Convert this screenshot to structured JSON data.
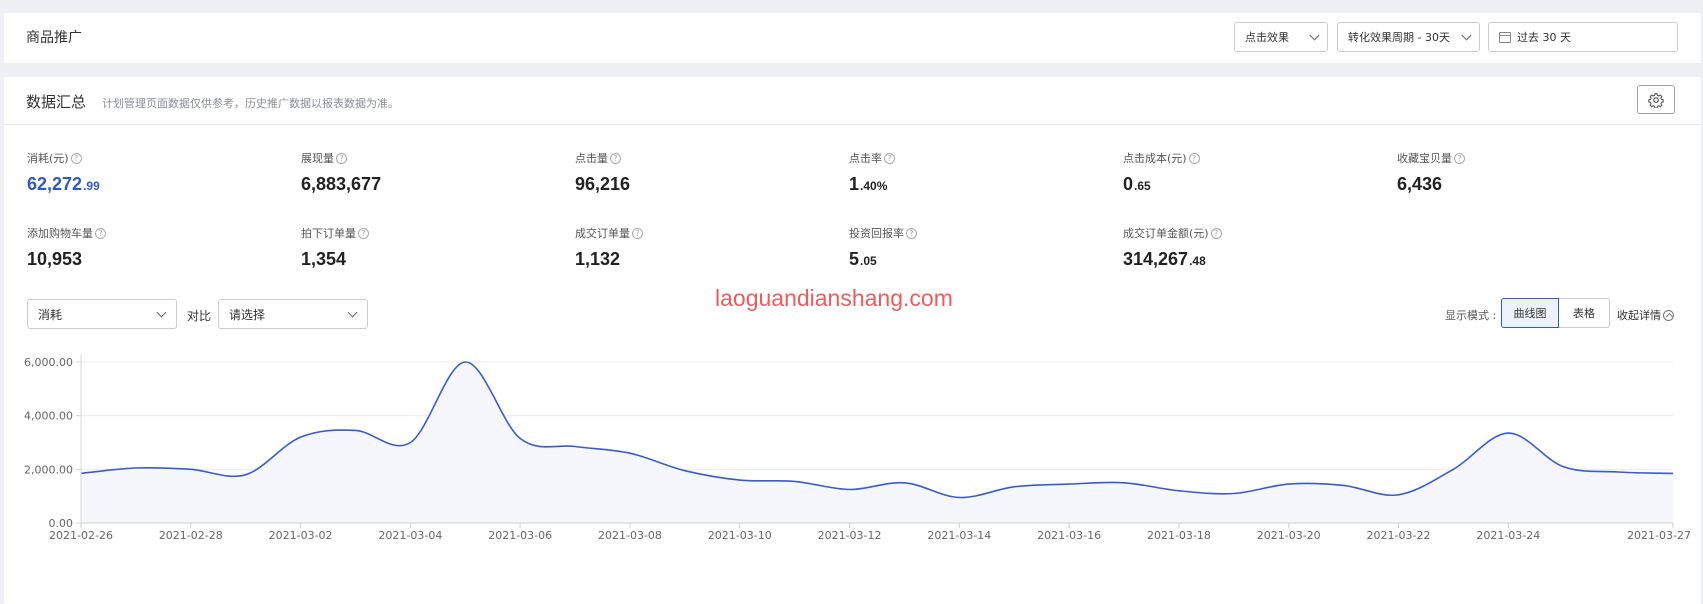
{
  "header": {
    "title": "商品推广",
    "dropdown_effect": "点击效果",
    "dropdown_period": "转化效果周期 - 30天",
    "date_range": "过去 30 天"
  },
  "summary": {
    "title": "数据汇总",
    "note": "计划管理页面数据仅供参考，历史推广数据以报表数据为准。",
    "metrics": [
      {
        "label": "消耗(元)",
        "int": "62,272",
        "dec": ".99"
      },
      {
        "label": "展现量",
        "int": "6,883,677",
        "dec": ""
      },
      {
        "label": "点击量",
        "int": "96,216",
        "dec": ""
      },
      {
        "label": "点击率",
        "int": "1",
        "dec": ".40%"
      },
      {
        "label": "点击成本(元)",
        "int": "0",
        "dec": ".65"
      },
      {
        "label": "收藏宝贝量",
        "int": "6,436",
        "dec": ""
      },
      {
        "label": "添加购物车量",
        "int": "10,953",
        "dec": ""
      },
      {
        "label": "拍下订单量",
        "int": "1,354",
        "dec": ""
      },
      {
        "label": "成交订单量",
        "int": "1,132",
        "dec": ""
      },
      {
        "label": "投资回报率",
        "int": "5",
        "dec": ".05"
      },
      {
        "label": "成交订单金额(元)",
        "int": "314,267",
        "dec": ".48"
      }
    ],
    "accent_color": "#3158c9"
  },
  "controls": {
    "metric_select": "消耗",
    "compare_label": "对比",
    "compare_select": "请选择",
    "mode_label": "显示模式 :",
    "mode_curve": "曲线图",
    "mode_table": "表格",
    "collapse": "收起详情"
  },
  "watermark": "laoguandianshang.com",
  "chart_data": {
    "type": "area",
    "line_color": "#3a5bd0",
    "fill_color": "#f5f7fc",
    "grid": true,
    "ylim": [
      0,
      6000
    ],
    "y_ticks": [
      "0.00",
      "2,000.00",
      "4,000.00",
      "6,000.00"
    ],
    "y_tick_values": [
      0,
      2000,
      4000,
      6000
    ],
    "x_ticks": [
      "2021-02-26",
      "2021-02-28",
      "2021-03-02",
      "2021-03-04",
      "2021-03-06",
      "2021-03-08",
      "2021-03-10",
      "2021-03-12",
      "2021-03-14",
      "2021-03-16",
      "2021-03-18",
      "2021-03-20",
      "2021-03-22",
      "2021-03-24",
      "2021-03-27"
    ],
    "x": [
      "2021-02-26",
      "2021-02-27",
      "2021-02-28",
      "2021-03-01",
      "2021-03-02",
      "2021-03-03",
      "2021-03-04",
      "2021-03-05",
      "2021-03-06",
      "2021-03-07",
      "2021-03-08",
      "2021-03-09",
      "2021-03-10",
      "2021-03-11",
      "2021-03-12",
      "2021-03-13",
      "2021-03-14",
      "2021-03-15",
      "2021-03-16",
      "2021-03-17",
      "2021-03-18",
      "2021-03-19",
      "2021-03-20",
      "2021-03-21",
      "2021-03-22",
      "2021-03-23",
      "2021-03-24",
      "2021-03-25",
      "2021-03-26",
      "2021-03-27"
    ],
    "values": [
      1850,
      2050,
      2000,
      1800,
      3200,
      3450,
      3000,
      6000,
      3150,
      2850,
      2600,
      1950,
      1600,
      1550,
      1250,
      1500,
      950,
      1350,
      1450,
      1500,
      1200,
      1100,
      1450,
      1400,
      1050,
      2000,
      3350,
      2100,
      1900,
      1850
    ]
  }
}
